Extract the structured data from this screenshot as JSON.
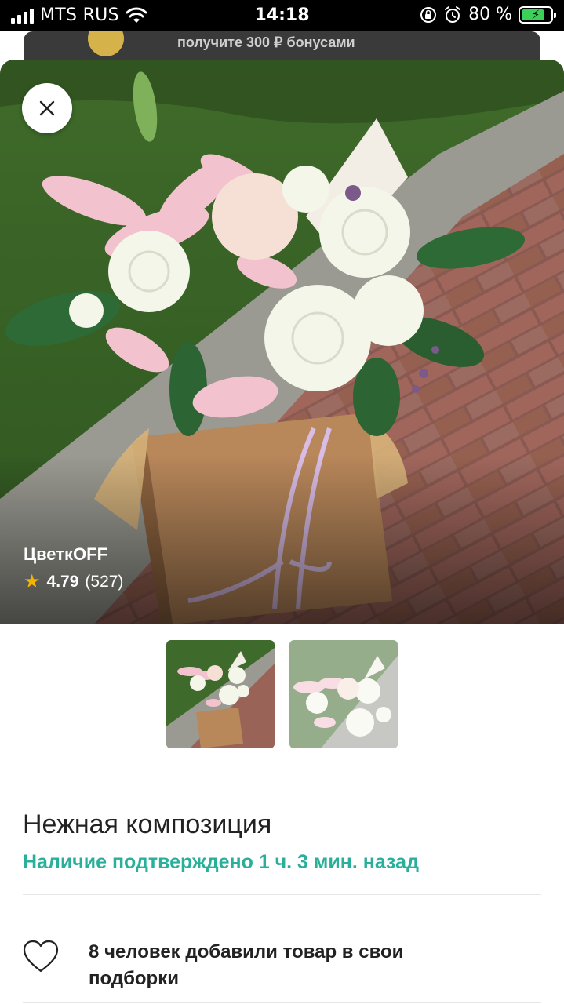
{
  "status_bar": {
    "carrier": "MTS RUS",
    "time": "14:18",
    "battery_percent": "80 %",
    "battery_level": 0.8
  },
  "banner": {
    "text": "получите 300 ₽ бонусами"
  },
  "hero": {
    "close_icon": "close-icon",
    "shop_name": "ЦветкOFF",
    "rating": "4.79",
    "reviews": "(527)"
  },
  "thumbnails": [
    {
      "name": "thumbnail-1",
      "selected": true
    },
    {
      "name": "thumbnail-2",
      "selected": false
    }
  ],
  "product": {
    "title": "Нежная композиция",
    "availability": "Наличие подтверждено 1 ч. 3 мин. назад",
    "favorites_text": "8 человек добавили товар в свои подборки"
  },
  "colors": {
    "accent_teal": "#2ab09a",
    "star": "#f4b400"
  }
}
